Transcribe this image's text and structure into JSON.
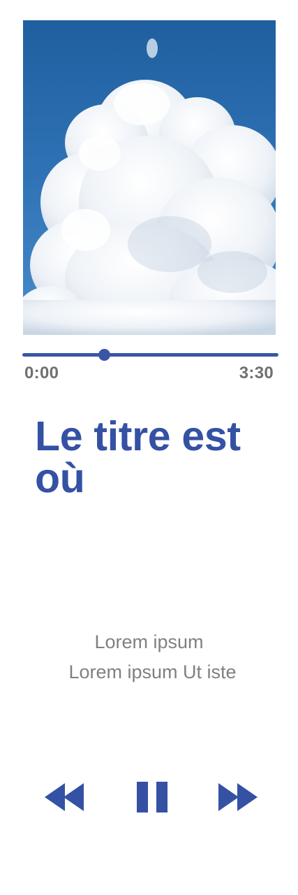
{
  "player": {
    "artwork_alt": "cloud artwork",
    "progress": {
      "current_time": "0:00",
      "total_time": "3:30",
      "fraction": 0.32
    },
    "title": "Le titre est où",
    "subtitle_line1": "Lorem ipsum",
    "subtitle_line2": "Lorem ipsum Ut iste",
    "controls": {
      "rewind_icon": "rewind-icon",
      "pause_icon": "pause-icon",
      "forward_icon": "fast-forward-icon"
    },
    "colors": {
      "accent": "#3551a4",
      "muted_text": "#808080",
      "time_text": "#707070"
    }
  }
}
